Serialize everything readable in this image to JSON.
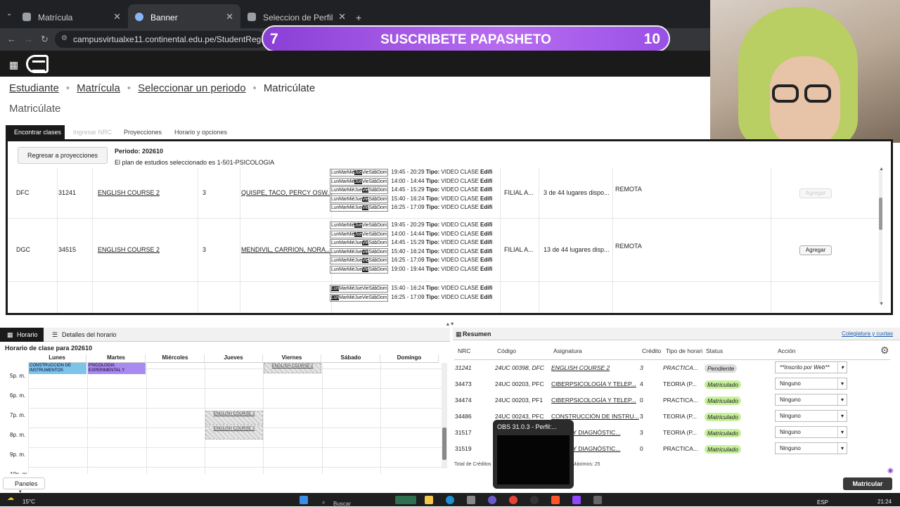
{
  "browser": {
    "tabs": [
      {
        "label": "Matrícula"
      },
      {
        "label": "Banner"
      },
      {
        "label": "Seleccion de Perfil"
      }
    ],
    "new_tab": "+",
    "url": "campusvirtualxe11.continental.edu.pe/StudentRegistrationSsb/ssb"
  },
  "overlay_banner": {
    "left": "7",
    "text": "SUSCRIBETE PAPASHETO",
    "right": "10"
  },
  "breadcrumb": [
    "Estudiante",
    "Matrícula",
    "Seleccionar un periodo",
    "Matricúlate"
  ],
  "page_title": "Matricúlate",
  "tabs": [
    "Encontrar clases",
    "Ingresar NRC",
    "Proyecciones",
    "Horario y opciones"
  ],
  "panel": {
    "back_button": "Regresar a proyecciones",
    "period": "Periodo: 202610",
    "plan": "El plan de estudios seleccionado es 1-501-PSICOLOGIA"
  },
  "days_labels": [
    "Lun",
    "Mar",
    "Mié",
    "Jue",
    "Vie",
    "Sáb",
    "Dom"
  ],
  "classes": [
    {
      "sec": "DFC",
      "nrc": "31241",
      "course": "ENGLISH COURSE 2",
      "credits": "3",
      "teacher": "QUISPE, TACO, PERCY OSW...",
      "schedule": [
        {
          "day": 3,
          "text": "19:45 - 20:29",
          "tipo": "Tipo:",
          "val": "VIDEO CLASE",
          "edif": "Edifi"
        },
        {
          "day": 3,
          "text": "14:00 - 14:44",
          "tipo": "Tipo:",
          "val": "VIDEO CLASE",
          "edif": "Edifi"
        },
        {
          "day": 4,
          "text": "14:45 - 15:29",
          "tipo": "Tipo:",
          "val": "VIDEO CLASE",
          "edif": "Edifi"
        },
        {
          "day": 4,
          "text": "15:40 - 16:24",
          "tipo": "Tipo:",
          "val": "VIDEO CLASE",
          "edif": "Edifi"
        },
        {
          "day": 4,
          "text": "16:25 - 17:09",
          "tipo": "Tipo:",
          "val": "VIDEO CLASE",
          "edif": "Edifi"
        }
      ],
      "campus": "FILIAL A...",
      "seats": "3 de 44 lugares dispo...",
      "mode": "REMOTA",
      "action": "Agregar",
      "disabled": true
    },
    {
      "sec": "DGC",
      "nrc": "34515",
      "course": "ENGLISH COURSE 2",
      "credits": "3",
      "teacher": "MENDIVIL, CARRION, NORA...",
      "schedule": [
        {
          "day": 3,
          "text": "19:45 - 20:29",
          "tipo": "Tipo:",
          "val": "VIDEO CLASE",
          "edif": "Edifi"
        },
        {
          "day": 3,
          "text": "14:00 - 14:44",
          "tipo": "Tipo:",
          "val": "VIDEO CLASE",
          "edif": "Edifi"
        },
        {
          "day": 4,
          "text": "14:45 - 15:29",
          "tipo": "Tipo:",
          "val": "VIDEO CLASE",
          "edif": "Edifi"
        },
        {
          "day": 4,
          "text": "15:40 - 16:24",
          "tipo": "Tipo:",
          "val": "VIDEO CLASE",
          "edif": "Edifi"
        },
        {
          "day": 4,
          "text": "16:25 - 17:09",
          "tipo": "Tipo:",
          "val": "VIDEO CLASE",
          "edif": "Edifi"
        },
        {
          "day": 4,
          "text": "19:00 - 19:44",
          "tipo": "Tipo:",
          "val": "VIDEO CLASE",
          "edif": "Edifi"
        }
      ],
      "campus": "FILIAL A...",
      "seats": "13 de 44 lugares disp...",
      "mode": "REMOTA",
      "action": "Agregar",
      "disabled": false
    },
    {
      "schedule": [
        {
          "day": 0,
          "text": "15:40 - 16:24",
          "tipo": "Tipo:",
          "val": "VIDEO CLASE",
          "edif": "Edifi"
        },
        {
          "day": 0,
          "text": "16:25 - 17:09",
          "tipo": "Tipo:",
          "val": "VIDEO CLASE",
          "edif": "Edifi"
        }
      ]
    }
  ],
  "lower": {
    "tab_horario": "Horario",
    "tab_detalles": "Detalles del horario",
    "cal_title": "Horario de clase para 202610",
    "days": [
      "Lunes",
      "Martes",
      "Miércoles",
      "Jueves",
      "Viernes",
      "Sábado",
      "Domingo"
    ],
    "hours": [
      "5p. m.",
      "6p. m.",
      "7p. m.",
      "8p. m.",
      "9p. m.",
      "10p. m."
    ],
    "events": {
      "lunes": "CONSTRUCCION DE INSTRUMENTOS",
      "martes": "PSICOLOGIA EXPERIMENTAL Y",
      "viernes": "ENGLISH COURSE 2",
      "jueves1": "ENGLISH COURSE 2",
      "jueves2": "ENGLISH COURSE 2"
    },
    "panels_button": "Paneles"
  },
  "resumen": {
    "title": "Resumen",
    "link": "Colegiatura y cuotas",
    "headers": [
      "NRC",
      "Código",
      "Asignatura",
      "Crédito",
      "Tipo de horari",
      "Status",
      "Acción"
    ],
    "rows": [
      {
        "nrc": "31241",
        "code": "24UC 00398, DFC",
        "subject": "ENGLISH COURSE 2",
        "credit": "3",
        "tipo": "PRACTICA...",
        "status": "Pendiente",
        "action": "**Inscrito por Web**"
      },
      {
        "nrc": "34473",
        "code": "24UC 00203, PFC",
        "subject": "CIBERPSICOLOGÍA Y TELEP...",
        "credit": "4",
        "tipo": "TEORIA (P...",
        "status": "Matriculado",
        "action": "Ninguno"
      },
      {
        "nrc": "34474",
        "code": "24UC 00203, PF1",
        "subject": "CIBERPSICOLOGÍA Y TELEP...",
        "credit": "0",
        "tipo": "PRACTICA...",
        "status": "Matriculado",
        "action": "Ninguno"
      },
      {
        "nrc": "34486",
        "code": "24UC 00243, PFC",
        "subject": "CONSTRUCCIÓN DE INSTRU...",
        "credit": "3",
        "tipo": "TEORIA (P...",
        "status": "Matriculado",
        "action": "Ninguno"
      },
      {
        "nrc": "31517",
        "code": "24UC 00",
        "subject": "...CIÓN Y DIAGNÓSTIC...",
        "credit": "3",
        "tipo": "TEORIA (P...",
        "status": "Matriculado",
        "action": "Ninguno"
      },
      {
        "nrc": "31519",
        "code": "24UC 00",
        "subject": "...CIÓN Y DIAGNÓSTIC...",
        "credit": "0",
        "tipo": "PRACTICA...",
        "status": "Matriculado",
        "action": "Ninguno"
      }
    ],
    "footer": "Total de Créditos ... 0 | Créditos Mínimos: 7 | Créditos Máximos: 25",
    "submit": "Matricular"
  },
  "obs_popup": {
    "title": "OBS 31.0.3 - Perfil:..."
  },
  "taskbar": {
    "weather": "15°C",
    "search": "Buscar",
    "lang": "ESP",
    "time": "21:24"
  }
}
